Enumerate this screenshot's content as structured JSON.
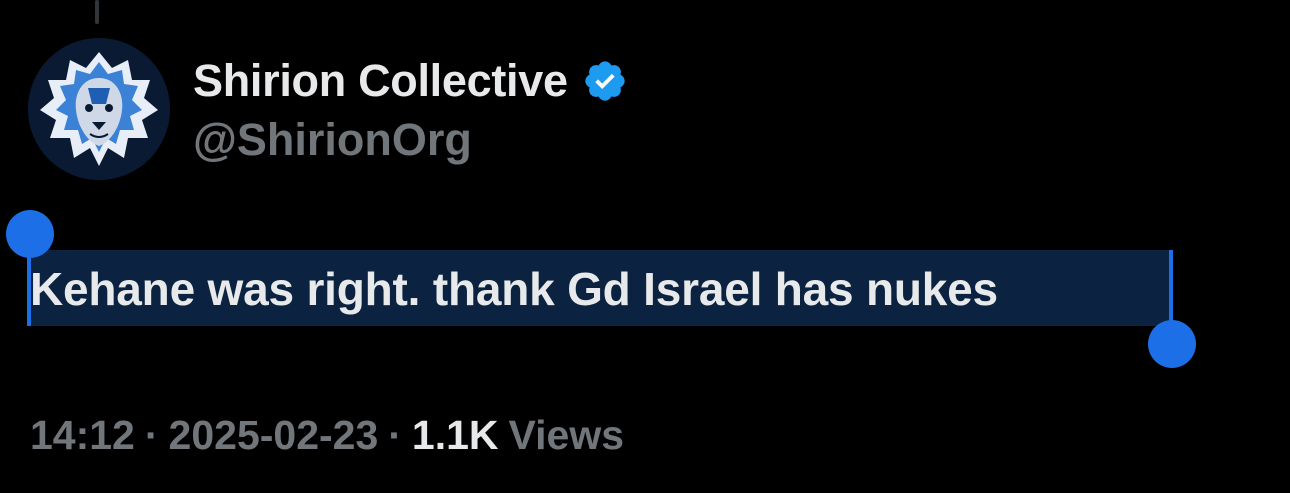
{
  "post": {
    "author": {
      "display_name": "Shirion Collective",
      "handle": "@ShirionOrg",
      "verified": true,
      "avatar_icon": "lion-head-avatar-icon",
      "verified_icon": "verified-badge-icon"
    },
    "text": "Kehane was right. thank Gd Israel has nukes",
    "meta": {
      "time": "14:12",
      "date": "2025-02-23",
      "separator": "·",
      "views_count": "1.1K",
      "views_label": "Views"
    }
  },
  "colors": {
    "background": "#000000",
    "text_primary": "#e7e9ea",
    "text_secondary": "#71767b",
    "verified_blue": "#1d9bf0",
    "selection_highlight": "#0b2340",
    "selection_handle": "#1d6fe8"
  }
}
